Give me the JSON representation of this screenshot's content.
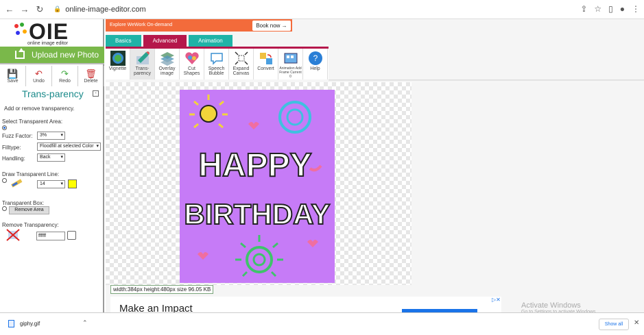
{
  "browser": {
    "url": "online-image-editor.com"
  },
  "logo": {
    "big": "OIE",
    "sub": "online image editor"
  },
  "left": {
    "upload_label": "Upload new Photo",
    "tools": [
      {
        "label": "Save"
      },
      {
        "label": "Undo"
      },
      {
        "label": "Redo"
      },
      {
        "label": "Delete"
      }
    ],
    "panel_title": "Trans-parency",
    "description": "Add or remove transparency.",
    "select_area_label": "Select Transparent Area:",
    "fuzz_label": "Fuzz Factor:",
    "fuzz_value": "3%",
    "filltype_label": "Filltype:",
    "filltype_value": "Floodfill at selected Color",
    "handling_label": "Handling:",
    "handling_value": "Back",
    "draw_line_label": "Draw Transparent Line:",
    "line_size": "14",
    "line_color": "#ffff00",
    "transparent_box_label": "Transparent Box:",
    "remove_area_label": "Remove Area",
    "remove_transparency_label": "Remove Transparency:",
    "color_value": "ffffff"
  },
  "ad_top": {
    "text": "Explore WeWork On-demand",
    "button": "Book now →"
  },
  "tabs": [
    {
      "label": "Basics"
    },
    {
      "label": "Advanced"
    },
    {
      "label": "Animation"
    }
  ],
  "toolbar": [
    {
      "label": "Vignette"
    },
    {
      "label": "Trans- parency"
    },
    {
      "label": "Overlay image"
    },
    {
      "label": "Cut Shapes"
    },
    {
      "label": "Speech Bubble"
    },
    {
      "label": "Expand Canvas"
    },
    {
      "label": "Convert"
    },
    {
      "label": "Animation Add Frame Current 0"
    },
    {
      "label": "Help"
    }
  ],
  "canvas": {
    "line1": "HAPPY",
    "line2": "BIRTHDAY",
    "dims": "width:384px  height:480px  size 96.05 KB"
  },
  "ad_bottom": {
    "text": "Make an Impact"
  },
  "os": {
    "activate_title": "Activate Windows",
    "activate_sub": "Go to Settings to activate Windows."
  },
  "downloads": {
    "file": "giphy.gif",
    "show_all": "Show all"
  },
  "colors": {
    "accent": "#b5174b",
    "tab": "#1fb3a7",
    "upload": "#7ab84a",
    "card": "#c67bf7",
    "title": "#1a8a8a"
  }
}
